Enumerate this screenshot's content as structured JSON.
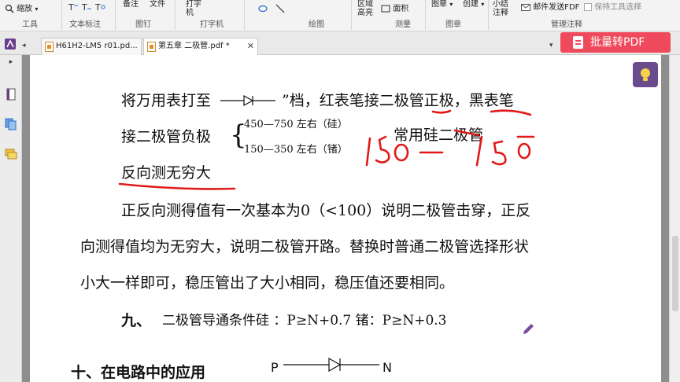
{
  "ribbon": {
    "zoom_label": "缩放",
    "tools_group": "工具",
    "text_annot_label": "文本标注",
    "pin_label": "备注",
    "file_label": "文件",
    "pin_group": "图钉",
    "typewriter_label": "打字机",
    "typewriter_group": "打字机",
    "drawing_group": "绘图",
    "area_label": "区域高亮",
    "face_label": "面积",
    "measure_group": "测量",
    "stamp_label": "图章",
    "create_label": "创建",
    "stamp_group": "图章",
    "summary_label": "小结注释",
    "email_label": "邮件发送FDF",
    "keep_tool_label": "保持工具选择",
    "manage_group": "管理注释"
  },
  "tabs": [
    {
      "label": "H61H2-LM5 r01.pd..."
    },
    {
      "label": "第五章 二极管.pdf *"
    }
  ],
  "convert_button": "批量转PDF",
  "document": {
    "line1": "将万用表打至",
    "line1b": "”档，红表笔接二极管正极，黑表笔",
    "line2": "接二极管负极",
    "brace_row1": "450—750  左右（硅）",
    "brace_row2": "150—350  左右（锗）",
    "common_si": "常用硅二极管",
    "line3": "反向测无穷大",
    "para1": "正反向测得值有一次基本为0（<100）说明二极管击穿，正反",
    "para2": "向测得值均为无穷大，说明二极管开路。替换时普通二极管选择形状",
    "para3": "小大一样即可，稳压管出了大小相同，稳压值还要相同。",
    "section9_num": "九、",
    "section9_text": "二极管导通条件硅 ：P≥N+0.7  锗：P≥N+0.3",
    "section10": "十、在电路中的应用",
    "diode_p": "P",
    "diode_n": "N"
  },
  "colors": {
    "annotation_red": "#e01a1a",
    "convert_button_bg": "#ef4a5b",
    "tip_button_bg": "#6a4c8c"
  }
}
